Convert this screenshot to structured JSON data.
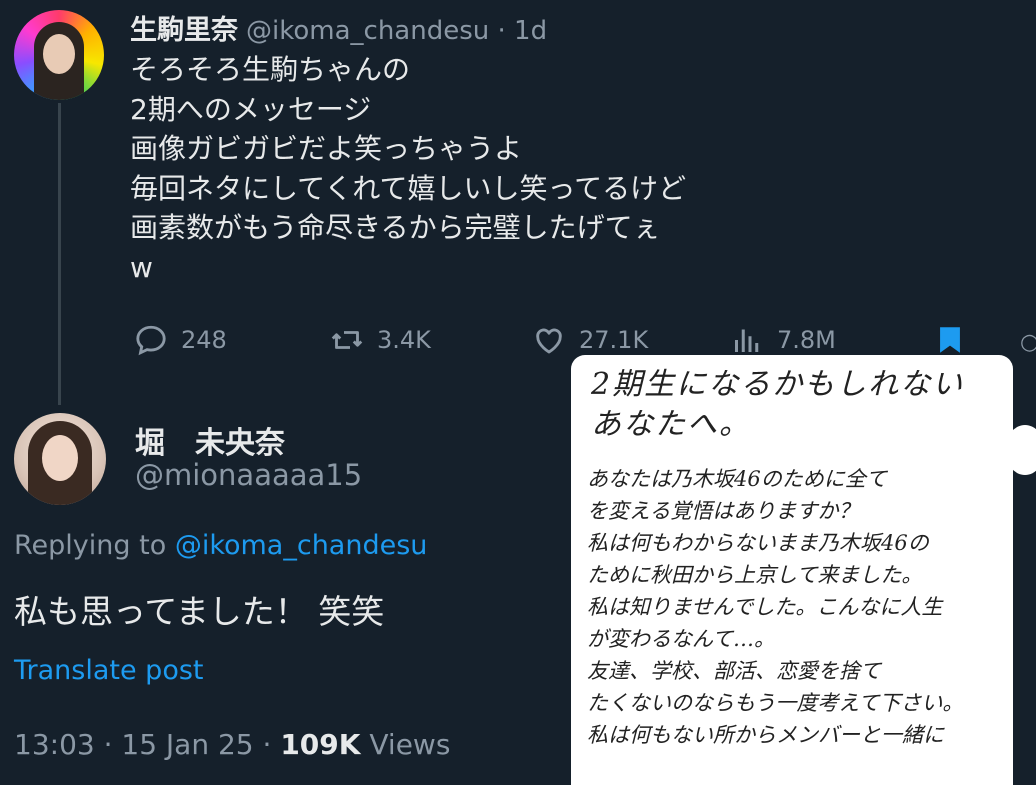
{
  "tweet": {
    "author_name": "生駒里奈",
    "author_handle": "@ikoma_chandesu",
    "time_ago": "· 1d",
    "lines": [
      "そろそろ生駒ちゃんの",
      "2期へのメッセージ",
      "画像ガビガビだよ笑っちゃうよ",
      "毎回ネタにしてくれて嬉しいし笑ってるけど",
      "画素数がもう命尽きるから完璧したげてぇ",
      "w"
    ],
    "actions": {
      "reply_count": "248",
      "retweet_count": "3.4K",
      "like_count": "27.1K",
      "view_count": "7.8M"
    },
    "icons": [
      "reply-icon",
      "retweet-icon",
      "like-icon",
      "views-icon",
      "bookmark-icon"
    ]
  },
  "reply": {
    "author_name": "堀　未央奈",
    "author_handle": "@mionaaaaa15",
    "replying_prefix": "Replying to ",
    "replying_to": "@ikoma_chandesu",
    "text": "私も思ってました！ 笑笑",
    "translate": "Translate post",
    "time": "13:03 · 15 Jan 25 · ",
    "views_count": "109K",
    "views_label": " Views"
  },
  "letter": {
    "heading": [
      "2期生になるかもしれない",
      "あなたへ。"
    ],
    "lines": [
      "あなたは乃木坂46のために全て",
      "を変える覚悟はありますか？",
      "私は何もわからないまま乃木坂46の",
      "ために秋田から上京して来ました。",
      "私は知りませんでした。こんなに人生",
      "が変わるなんて…。",
      "友達、学校、部活、恋愛を捨て",
      "たくないのならもう一度考えて下さい。",
      "私は何もない所からメンバーと一緒に"
    ]
  },
  "colors": {
    "background": "#15202b",
    "text": "#e7e9ea",
    "secondary": "#8b98a5",
    "link": "#1d9bf0",
    "bookmark": "#1d9bf0"
  }
}
